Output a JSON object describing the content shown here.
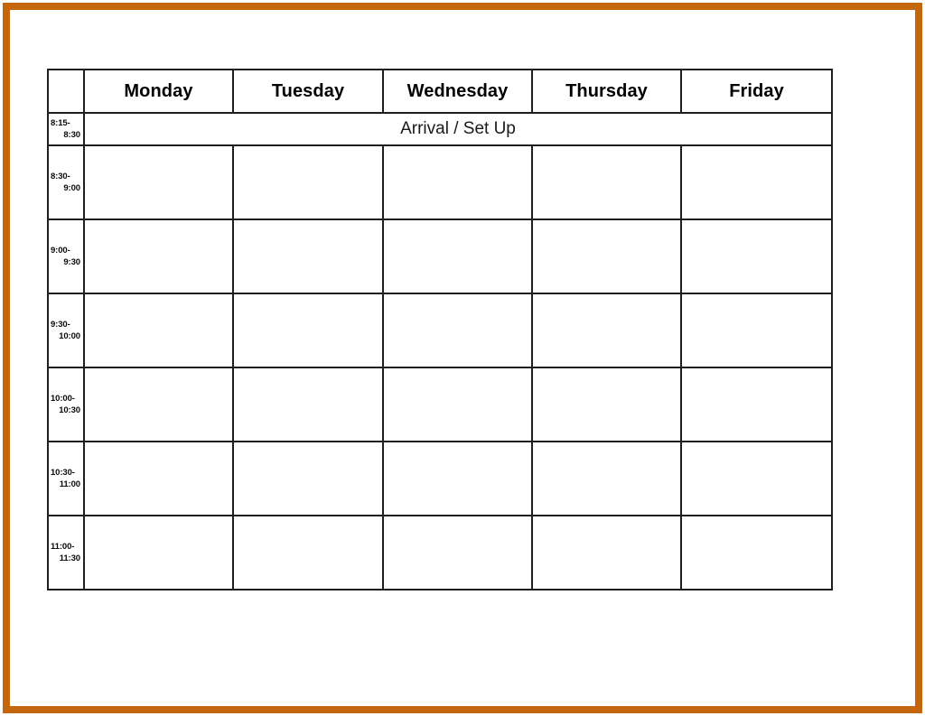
{
  "page": {
    "background_color": "#ffffff",
    "frame_color": "#c4660b",
    "border_color": "#1f1f1f"
  },
  "schedule": {
    "corner_label": "",
    "day_headers": [
      "Monday",
      "Tuesday",
      "Wednesday",
      "Thursday",
      "Friday"
    ],
    "arrival_row": {
      "time_start": "8:15-",
      "time_end": "8:30",
      "merged_label": "Arrival / Set Up"
    },
    "time_slots": [
      {
        "start": "8:30-",
        "end": "9:00"
      },
      {
        "start": "9:00-",
        "end": "9:30"
      },
      {
        "start": "9:30-",
        "end": "10:00"
      },
      {
        "start": "10:00-",
        "end": "10:30"
      },
      {
        "start": "10:30-",
        "end": "11:00"
      },
      {
        "start": "11:00-",
        "end": "11:30"
      }
    ],
    "cells": [
      [
        "",
        "",
        "",
        "",
        ""
      ],
      [
        "",
        "",
        "",
        "",
        ""
      ],
      [
        "",
        "",
        "",
        "",
        ""
      ],
      [
        "",
        "",
        "",
        "",
        ""
      ],
      [
        "",
        "",
        "",
        "",
        ""
      ],
      [
        "",
        "",
        "",
        "",
        ""
      ]
    ]
  }
}
